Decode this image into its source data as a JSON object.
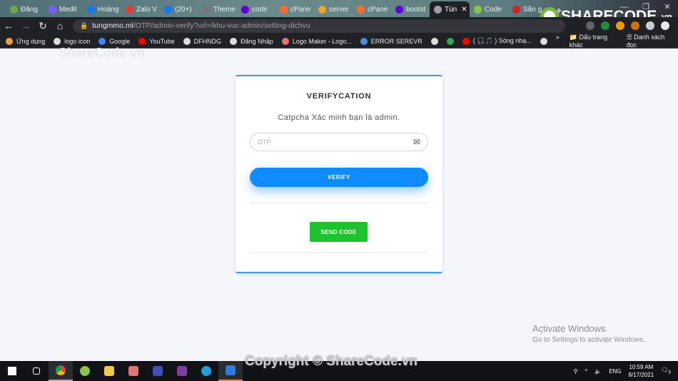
{
  "browser": {
    "tabs": [
      {
        "label": "Đăng",
        "color": "#6aa84f"
      },
      {
        "label": "Medit",
        "color": "#7c5cff"
      },
      {
        "label": "Hoàng",
        "color": "#1877f2"
      },
      {
        "label": "Zalo V",
        "color": "#e53935"
      },
      {
        "label": "(20+)",
        "color": "#1877f2"
      },
      {
        "label": "Theme",
        "color": "#777777"
      },
      {
        "label": "code",
        "color": "#6001d2"
      },
      {
        "label": "cPane",
        "color": "#ff6c2c"
      },
      {
        "label": "server",
        "color": "#f0a030"
      },
      {
        "label": "cPane",
        "color": "#ff6c2c"
      },
      {
        "label": "bootst",
        "color": "#6001d2"
      },
      {
        "label": "Tùn",
        "color": "#9aa0a6",
        "active": true
      },
      {
        "label": "Code",
        "color": "#8bc34a"
      },
      {
        "label": "Săn g",
        "color": "#c62828"
      }
    ],
    "url_host": "tungmmo.ml",
    "url_path": "/OTP/admin-verify?url=/khu-vuc-admin/setting-dichvu",
    "bookmarks": [
      "Ứng dụng",
      "logo icon",
      "Google",
      "YouTube",
      "DFHNDG",
      "Đăng Nhập",
      "Logo Maker - Logo...",
      "ERROR SEREVR",
      "",
      "",
      "( 🎧🎵 ) Sóng nhạ...",
      ""
    ],
    "bookmarks_more": "»",
    "other_bookmarks": "Dấu trang khác",
    "reading_list": "Danh sách đọc"
  },
  "watermark": {
    "top": "ShareCode.vn",
    "logo": "SHARECODE",
    "logo_suffix": ".vn",
    "copyright": "Copyright © ShareCode.vn"
  },
  "card": {
    "title": "VERIFYCATION",
    "subtitle": "Catpcha Xác minh bạn là admin.",
    "otp_placeholder": "OTP",
    "otp_value": "",
    "verify_label": "VERIFY",
    "send_code_label": "SEND CODE",
    "colors": {
      "accent": "#0f8bff",
      "send": "#1ec22e",
      "border": "#3d9be0"
    }
  },
  "activation": {
    "title": "Activate Windows",
    "subtitle": "Go to Settings to activate Windows."
  },
  "taskbar": {
    "lang": "ENG",
    "time": "10:59 AM",
    "date": "8/17/2021",
    "notifications": "3"
  }
}
